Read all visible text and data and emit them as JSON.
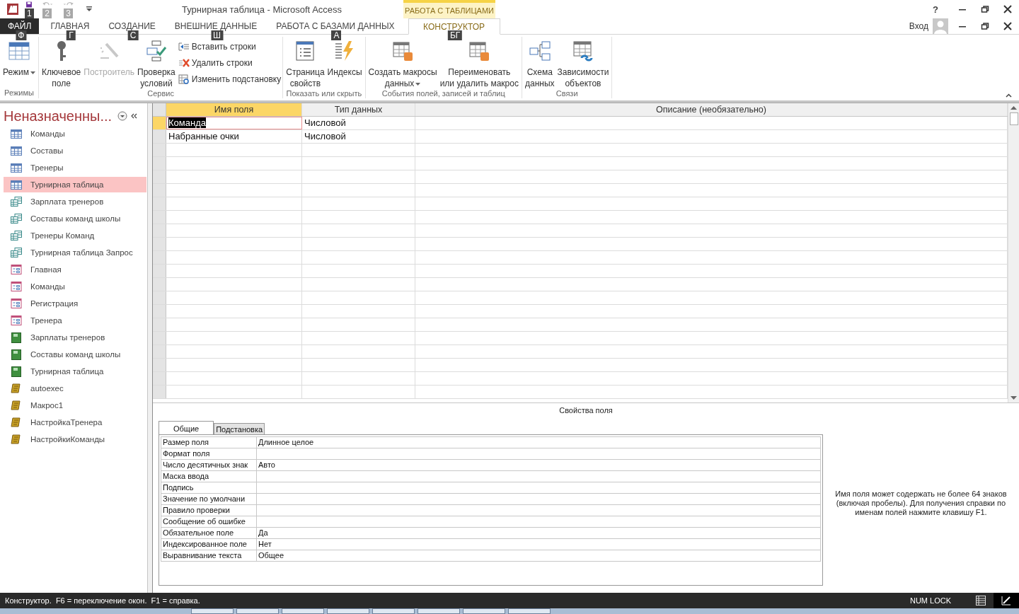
{
  "title_bar": {
    "title": "Турнирная таблица - Microsoft Access",
    "context_header": "РАБОТА С ТАБЛИЦАМИ",
    "help": "?",
    "account": "Вход"
  },
  "quick_access": [
    {
      "keytip": "1",
      "disabled": false
    },
    {
      "keytip": "2",
      "disabled": true
    },
    {
      "keytip": "3",
      "disabled": true
    }
  ],
  "tabs": [
    {
      "label": "ФАЙЛ",
      "kind": "file",
      "keytip": "Ф",
      "selected": false
    },
    {
      "label": "ГЛАВНАЯ",
      "kind": "normal",
      "keytip": "Г",
      "selected": false
    },
    {
      "label": "СОЗДАНИЕ",
      "kind": "normal",
      "keytip": "С",
      "selected": false
    },
    {
      "label": "ВНЕШНИЕ ДАННЫЕ",
      "kind": "normal",
      "keytip": "Ш",
      "selected": false
    },
    {
      "label": "РАБОТА С БАЗАМИ ДАННЫХ",
      "kind": "normal",
      "keytip": "А",
      "selected": false
    },
    {
      "label": "КОНСТРУКТОР",
      "kind": "context",
      "keytip": "БГ",
      "selected": true
    }
  ],
  "ribbon": [
    {
      "label": "Режимы",
      "buttons": [
        {
          "label": "Режим",
          "kind": "large",
          "dropdown": true,
          "disabled": false
        }
      ]
    },
    {
      "label": "Сервис",
      "buttons": [
        {
          "label": "Ключевое\nполе",
          "kind": "large",
          "dropdown": false,
          "disabled": false
        },
        {
          "label": "Построитель",
          "kind": "large",
          "dropdown": false,
          "disabled": true
        },
        {
          "label": "Проверка\nусловий",
          "kind": "large",
          "dropdown": false,
          "disabled": false
        },
        {
          "label": "Вставить строки",
          "kind": "small",
          "disabled": false
        },
        {
          "label": "Удалить строки",
          "kind": "small",
          "disabled": false
        },
        {
          "label": "Изменить подстановку",
          "kind": "small",
          "disabled": false
        }
      ]
    },
    {
      "label": "Показать или скрыть",
      "buttons": [
        {
          "label": "Страница\nсвойств",
          "kind": "large",
          "dropdown": false,
          "disabled": false
        },
        {
          "label": "Индексы",
          "kind": "large",
          "dropdown": false,
          "disabled": false
        }
      ]
    },
    {
      "label": "События полей, записей и таблиц",
      "buttons": [
        {
          "label": "Создать макросы\nданных",
          "kind": "large",
          "dropdown": true,
          "disabled": false
        },
        {
          "label": "Переименовать\nили удалить макрос",
          "kind": "large",
          "dropdown": false,
          "disabled": false
        }
      ]
    },
    {
      "label": "Связи",
      "buttons": [
        {
          "label": "Схема\nданных",
          "kind": "large",
          "dropdown": false,
          "disabled": false
        },
        {
          "label": "Зависимости\nобъектов",
          "kind": "large",
          "dropdown": false,
          "disabled": false
        }
      ]
    }
  ],
  "navigation": {
    "title": "Неназначенны...",
    "items": [
      {
        "label": "Команды",
        "kind": "table",
        "selected": false
      },
      {
        "label": "Составы",
        "kind": "table",
        "selected": false
      },
      {
        "label": "Тренеры",
        "kind": "table",
        "selected": false
      },
      {
        "label": "Турнирная таблица",
        "kind": "table",
        "selected": true
      },
      {
        "label": "Зарплата тренеров",
        "kind": "query",
        "selected": false
      },
      {
        "label": "Составы команд школы",
        "kind": "query",
        "selected": false
      },
      {
        "label": "Тренеры Команд",
        "kind": "query",
        "selected": false
      },
      {
        "label": "Турнирная таблица Запрос",
        "kind": "query",
        "selected": false
      },
      {
        "label": "Главная",
        "kind": "form",
        "selected": false
      },
      {
        "label": "Команды",
        "kind": "form",
        "selected": false
      },
      {
        "label": "Регистрация",
        "kind": "form",
        "selected": false
      },
      {
        "label": "Тренера",
        "kind": "form",
        "selected": false
      },
      {
        "label": "Зарплаты тренеров",
        "kind": "report",
        "selected": false
      },
      {
        "label": "Составы команд школы",
        "kind": "report",
        "selected": false
      },
      {
        "label": "Турнирная таблица",
        "kind": "report",
        "selected": false
      },
      {
        "label": "autoexec",
        "kind": "macro",
        "selected": false
      },
      {
        "label": "Макрос1",
        "kind": "macro",
        "selected": false
      },
      {
        "label": "НастройкаТренера",
        "kind": "macro",
        "selected": false
      },
      {
        "label": "НастройкиКоманды",
        "kind": "macro",
        "selected": false
      }
    ]
  },
  "design_grid": {
    "columns": [
      "Имя поля",
      "Тип данных",
      "Описание (необязательно)"
    ],
    "rows": [
      {
        "field_name": "Команда",
        "data_type": "Числовой",
        "selected": true
      },
      {
        "field_name": "Набранные очки",
        "data_type": "Числовой",
        "selected": false
      }
    ]
  },
  "field_properties": {
    "title": "Свойства поля",
    "tabs": [
      {
        "label": "Общие",
        "selected": true
      },
      {
        "label": "Подстановка",
        "selected": false
      }
    ],
    "rows": [
      {
        "name": "Размер поля",
        "value": "Длинное целое"
      },
      {
        "name": "Формат поля"
      },
      {
        "name": "Число десятичных знак",
        "value": "Авто"
      },
      {
        "name": "Маска ввода"
      },
      {
        "name": "Подпись"
      },
      {
        "name": "Значение по умолчани"
      },
      {
        "name": "Правило проверки"
      },
      {
        "name": "Сообщение об ошибке"
      },
      {
        "name": "Обязательное поле",
        "value": "Да"
      },
      {
        "name": "Индексированное поле",
        "value": "Нет"
      },
      {
        "name": "Выравнивание текста",
        "value": "Общее"
      }
    ],
    "help": "Имя поля может содержать не более 64 знаков (включая пробелы). Для получения справки по именам полей нажмите клавишу F1."
  },
  "status_bar": {
    "message": "Конструктор.  F6 = переключение окон.  F1 = справка.",
    "indicator": "NUM LOCK",
    "views": [
      {
        "selected": false
      },
      {
        "selected": true
      }
    ]
  }
}
